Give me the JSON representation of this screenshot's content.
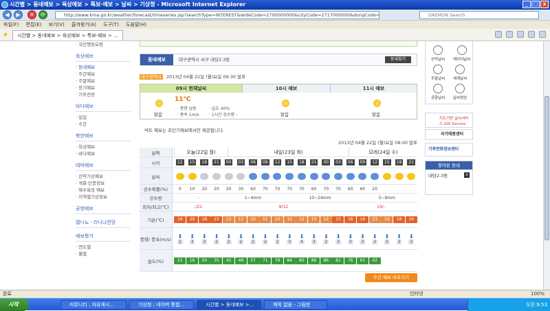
{
  "window": {
    "title": "시간별 > 동네예보 > 육상예보 > 특보·예보 > 날씨 > 기상청 - Microsoft Internet Explorer"
  },
  "address": {
    "url": "http://www.kma.go.kr/weather/forecast/timeseries.jsp?searchType=INTEREST&wideCode=2700000000&cityCode=2717000000&dongCode=2717068500",
    "search_placeholder": "DAEMON Search"
  },
  "menu": [
    "파일(F)",
    "편집(E)",
    "보기(V)",
    "즐겨찾기(A)",
    "도구(T)",
    "도움말(H)"
  ],
  "tab": {
    "label": "시간별 > 동네예보 > 육상예보 > 특보·예보 > ..."
  },
  "leftnav": {
    "top_item": "· 국민행동요령",
    "groups": [
      {
        "title": "육상예보",
        "items": [
          "· 동네예보",
          "· 주간예보",
          "· 주말예보",
          "· 장기예보",
          "· 기후전망"
        ]
      },
      {
        "title": "바다예보",
        "items": [
          "· 일일",
          "· 주간"
        ]
      },
      {
        "title": "북한예보",
        "items": [
          "· 육상예보",
          "· 바다예보"
        ]
      },
      {
        "title": "테마예보",
        "items": [
          "· 산악기상예보",
          "· 개화·단풍정보",
          "· 해수욕장 예보",
          "· 지역별기상정보"
        ]
      },
      {
        "title": "공항예보",
        "items": []
      },
      {
        "title": "엘니뇨 · 라니냐전망",
        "items": []
      },
      {
        "title": "예보평가",
        "items": [
          "· 연도별",
          "· 월별"
        ]
      }
    ]
  },
  "dong": {
    "label": "동네예보",
    "location": "대구광역시 서구 내당2.3동",
    "button": "동네찾기"
  },
  "announce": {
    "badge": "대구광역시",
    "text": "2013년 04월 22일 (월)요일 09:30 발표"
  },
  "now": {
    "h1": "09시 현재날씨",
    "h2": "10시 예보",
    "h3": "11시 예보",
    "temp": "11℃",
    "weather": "맑음",
    "wind": "· 풍향 남동",
    "speed": "· 풍속 1m/s",
    "humidity": "· 습도 40%",
    "precip": "· 1시간 강수량 -",
    "w2": "맑음",
    "w3": "맑음"
  },
  "note": "넥트 예보는 초단기예보에서만 제공됩니다.",
  "issued": "2013년 04월 22일 (월)요일 08:00 발표",
  "grid": {
    "labels": {
      "date": "날짜",
      "time": "시각",
      "sky": "날씨",
      "pop": "강수확률(%)",
      "rain": "강수량",
      "minmax": "최저/최고(℃)",
      "temp": "기온(℃)",
      "wind": "풍향/ 풍속(m/s)",
      "hum": "습도(%)"
    },
    "days": [
      "오늘(22일 월)",
      "내일(23일 화)",
      "모레(24일 수)"
    ],
    "hours": [
      "12",
      "15",
      "18",
      "21",
      "00",
      "03",
      "06",
      "09",
      "12",
      "15",
      "18",
      "21",
      "00",
      "03",
      "06",
      "09",
      "12",
      "15",
      "18",
      "21"
    ],
    "pop": [
      "0",
      "10",
      "20",
      "20",
      "20",
      "30",
      "60",
      "70",
      "70",
      "70",
      "70",
      "60",
      "70",
      "70",
      "60",
      "60",
      "20",
      "",
      "",
      ""
    ],
    "rain": [
      "-",
      "1~4mm",
      "10~24mm",
      "5~9mm"
    ],
    "minmax": [
      "-/21",
      "9/12",
      "14/-"
    ],
    "temp": [
      "16",
      "20",
      "18",
      "15",
      "12",
      "11",
      "10",
      "11",
      "10",
      "12",
      "12",
      "13",
      "12",
      "15",
      "16",
      "16",
      "13",
      "14",
      "18",
      "16"
    ],
    "wind": [
      "2",
      "3",
      "3",
      "2",
      "2",
      "2",
      "2",
      "2",
      "2",
      "3",
      "4",
      "3",
      "2",
      "3",
      "3",
      "3",
      "2",
      "3",
      "3",
      "3"
    ],
    "hum": [
      "21",
      "16",
      "20",
      "35",
      "42",
      "48",
      "57",
      "71",
      "79",
      "84",
      "85",
      "86",
      "86",
      "81",
      "76",
      "61",
      "42",
      "",
      "",
      ""
    ],
    "week_button": "주간 예보 바로가기"
  },
  "rightnav": {
    "icons": [
      "산악날씨",
      "레이더날씨",
      "주말날씨",
      "세계날씨",
      "공항날씨",
      "날씨영상"
    ],
    "gis": "지도기반 날씨서비스 GIS Service",
    "kwc": "국가태풍센터",
    "ccic": "기후변화정보센터",
    "fav_title": "찾아본 동네",
    "fav_item": "내당2.3동"
  },
  "status": {
    "left": "완료",
    "right": "인터넷",
    "zoom": "100%"
  },
  "taskbar": {
    "start": "시작",
    "items": [
      "커뮤니티 : 자유게시...",
      "기상청 : 네이버 통합...",
      "시간별 > 동네예보 >...",
      "제목 없음 - 그림판"
    ],
    "clock": "오전 9:53"
  }
}
